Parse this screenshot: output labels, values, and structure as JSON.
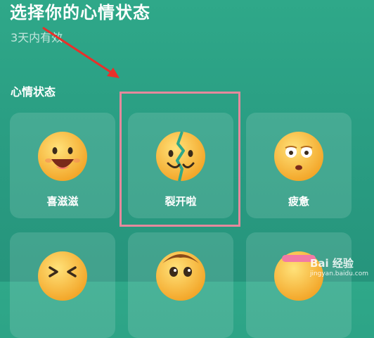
{
  "header": {
    "title": "选择你的心情状态",
    "subtitle": "3天内有效"
  },
  "section": {
    "label": "心情状态"
  },
  "moods": [
    {
      "label": "喜滋滋",
      "icon": "grinning-face-icon",
      "selected": false
    },
    {
      "label": "裂开啦",
      "icon": "cracked-face-icon",
      "selected": true
    },
    {
      "label": "疲惫",
      "icon": "tired-face-icon",
      "selected": false
    },
    {
      "label": "",
      "icon": "laughing-face-icon",
      "selected": false
    },
    {
      "label": "",
      "icon": "happy-face-icon",
      "selected": false
    },
    {
      "label": "",
      "icon": "face-icon",
      "selected": false
    }
  ],
  "annotation": {
    "highlight_color": "#e5899d",
    "arrow_color": "#e8302a"
  },
  "watermark": {
    "brand": "Bai 经验",
    "url": "jingyan.baidu.com"
  },
  "colors": {
    "background": "#2a9e83",
    "emoji_yellow": "#f8c23a"
  }
}
